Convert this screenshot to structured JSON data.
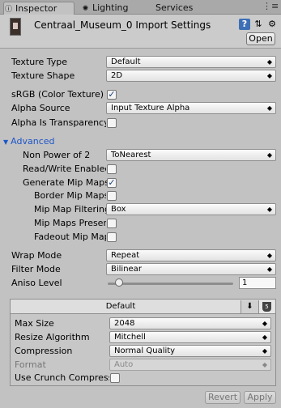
{
  "tabs": {
    "inspector": "Inspector",
    "lighting": "Lighting",
    "services": "Services",
    "menu_icon": "⋮≡"
  },
  "header": {
    "title": "Centraal_Museum_0 Import Settings",
    "open_label": "Open",
    "help_icon": "?",
    "preset_icon": "⇅",
    "gear_icon": "⚙"
  },
  "fields": {
    "texture_type": {
      "label": "Texture Type",
      "value": "Default"
    },
    "texture_shape": {
      "label": "Texture Shape",
      "value": "2D"
    },
    "srgb": {
      "label": "sRGB (Color Texture)",
      "checked": "✓"
    },
    "alpha_source": {
      "label": "Alpha Source",
      "value": "Input Texture Alpha"
    },
    "alpha_transparency": {
      "label": "Alpha Is Transparency",
      "checked": ""
    },
    "advanced": {
      "label": "Advanced"
    },
    "non_power_of_2": {
      "label": "Non Power of 2",
      "value": "ToNearest"
    },
    "read_write": {
      "label": "Read/Write Enabled",
      "checked": ""
    },
    "generate_mip": {
      "label": "Generate Mip Maps",
      "checked": "✓"
    },
    "border_mip": {
      "label": "Border Mip Maps",
      "checked": ""
    },
    "mip_filtering": {
      "label": "Mip Map Filtering",
      "value": "Box"
    },
    "mip_preserve": {
      "label": "Mip Maps Preserve Coverage",
      "checked": ""
    },
    "fadeout_mip": {
      "label": "Fadeout Mip Maps",
      "checked": ""
    },
    "wrap_mode": {
      "label": "Wrap Mode",
      "value": "Repeat"
    },
    "filter_mode": {
      "label": "Filter Mode",
      "value": "Bilinear"
    },
    "aniso_level": {
      "label": "Aniso Level",
      "value": "1",
      "slider_fraction": 0.06
    }
  },
  "platform": {
    "tab_label": "Default",
    "max_size": {
      "label": "Max Size",
      "value": "2048"
    },
    "resize_algorithm": {
      "label": "Resize Algorithm",
      "value": "Mitchell"
    },
    "compression": {
      "label": "Compression",
      "value": "Normal Quality"
    },
    "format": {
      "label": "Format",
      "value": "Auto"
    },
    "crunch": {
      "label": "Use Crunch Compression",
      "checked": ""
    }
  },
  "buttons": {
    "revert": "Revert",
    "apply": "Apply"
  }
}
